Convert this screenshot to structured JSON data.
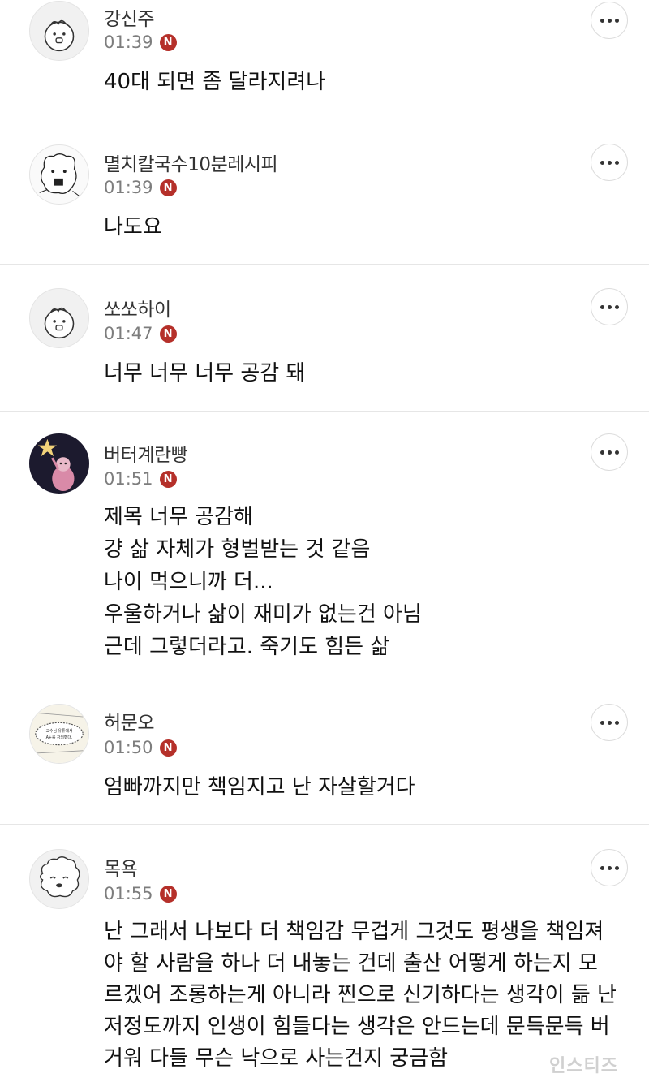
{
  "comments": [
    {
      "nickname": "강신주",
      "time": "01:39",
      "badge": "N",
      "text": "40대 되면 좀 달라지려나",
      "avatar": "default-face"
    },
    {
      "nickname": "멸치칼국수10분레시피",
      "time": "01:39",
      "badge": "N",
      "text": "나도요",
      "avatar": "sketch-dog"
    },
    {
      "nickname": "쏘쏘하이",
      "time": "01:47",
      "badge": "N",
      "text": "너무 너무 너무 공감 돼",
      "avatar": "default-face"
    },
    {
      "nickname": "버터계란빵",
      "time": "01:51",
      "badge": "N",
      "text": "제목 너무 공감해\n걍 삶 자체가 형벌받는 것 같음\n나이 먹으니까 더...\n우울하거나 삶이 재미가 없는건 아님\n근데 그렇더라고. 죽기도 힘든 삶",
      "avatar": "star-character"
    },
    {
      "nickname": "허문오",
      "time": "01:50",
      "badge": "N",
      "text": "엄빠까지만 책임지고 난 자살할거다",
      "avatar": "manga-panel"
    },
    {
      "nickname": "목욕",
      "time": "01:55",
      "badge": "N",
      "text": "난 그래서 나보다 더 책임감 무겁게 그것도 평생을 책임져야 할 사람을 하나 더 내놓는 건데 출산 어떻게 하는지 모르겠어 조롱하는게 아니라 찐으로 신기하다는 생각이 듦 난 저정도까지 인생이 힘들다는 생각은 안드는데 문득문득 버거워 다들 무슨 낙으로 사는건지 궁금함",
      "avatar": "fluffy-face"
    }
  ],
  "avatar_text": {
    "manga_line1": "교수님 유튜에서",
    "manga_line2": "A+를 강의했대."
  },
  "watermark": "인스티즈",
  "colors": {
    "badge": "#b5302a",
    "divider": "#e6e6e6",
    "time": "#7d7d7d",
    "nickname": "#333333"
  },
  "icons": {
    "more": "more-dots-icon",
    "new": "new-badge-icon"
  }
}
